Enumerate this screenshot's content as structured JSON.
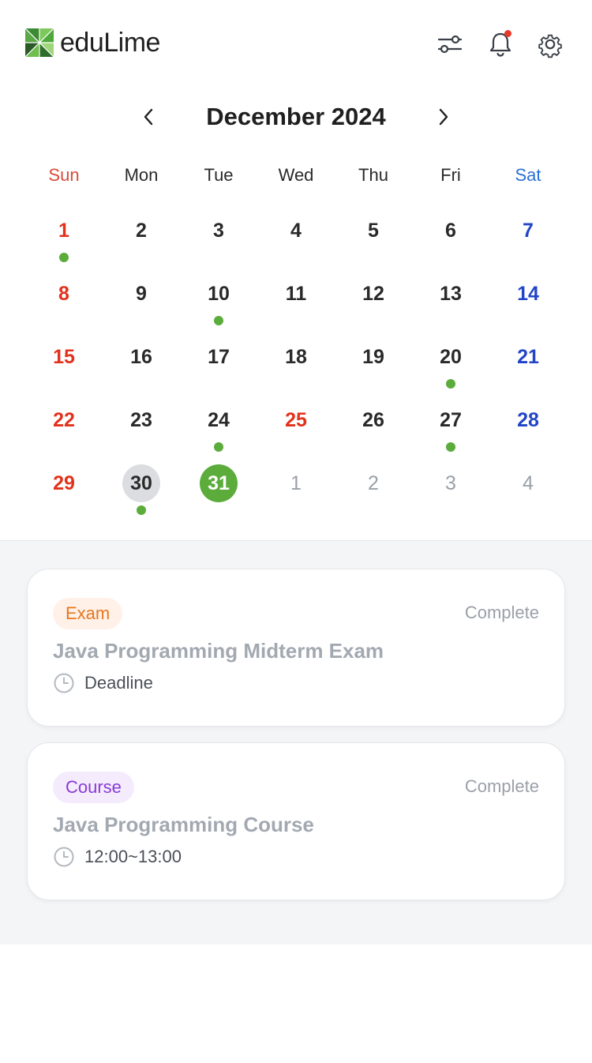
{
  "brand": {
    "name": "eduLime"
  },
  "calendar": {
    "month_title": "December 2024",
    "weekdays": [
      "Sun",
      "Mon",
      "Tue",
      "Wed",
      "Thu",
      "Fri",
      "Sat"
    ],
    "weeks": [
      [
        {
          "d": "1",
          "dot": true
        },
        {
          "d": "2"
        },
        {
          "d": "3"
        },
        {
          "d": "4"
        },
        {
          "d": "5"
        },
        {
          "d": "6"
        },
        {
          "d": "7"
        }
      ],
      [
        {
          "d": "8"
        },
        {
          "d": "9"
        },
        {
          "d": "10",
          "dot": true
        },
        {
          "d": "11"
        },
        {
          "d": "12"
        },
        {
          "d": "13"
        },
        {
          "d": "14"
        }
      ],
      [
        {
          "d": "15"
        },
        {
          "d": "16"
        },
        {
          "d": "17"
        },
        {
          "d": "18"
        },
        {
          "d": "19"
        },
        {
          "d": "20",
          "dot": true
        },
        {
          "d": "21"
        }
      ],
      [
        {
          "d": "22"
        },
        {
          "d": "23"
        },
        {
          "d": "24",
          "dot": true
        },
        {
          "d": "25",
          "holiday": true
        },
        {
          "d": "26"
        },
        {
          "d": "27",
          "dot": true
        },
        {
          "d": "28"
        }
      ],
      [
        {
          "d": "29"
        },
        {
          "d": "30",
          "dot": true,
          "today": true
        },
        {
          "d": "31",
          "selected": true
        },
        {
          "d": "1",
          "other": true
        },
        {
          "d": "2",
          "other": true
        },
        {
          "d": "3",
          "other": true
        },
        {
          "d": "4",
          "other": true
        }
      ]
    ]
  },
  "events": [
    {
      "tag": "Exam",
      "tag_type": "exam",
      "status": "Complete",
      "title": "Java Programming Midterm Exam",
      "time": "Deadline"
    },
    {
      "tag": "Course",
      "tag_type": "course",
      "status": "Complete",
      "title": "Java Programming Course",
      "time": "12:00~13:00"
    }
  ],
  "icons": {
    "logo": "edulime-logo-icon",
    "filter": "filter-sliders-icon",
    "notifications": "bell-icon",
    "settings": "gear-icon",
    "prev": "chevron-left-icon",
    "next": "chevron-right-icon",
    "time": "clock-icon"
  },
  "colors": {
    "accent": "#5cac3c",
    "sunday": "#e2321c",
    "saturday": "#2245c8",
    "notification_dot": "#e53a2a",
    "exam_tag": "#e8761e",
    "course_tag": "#8a3ad6"
  }
}
